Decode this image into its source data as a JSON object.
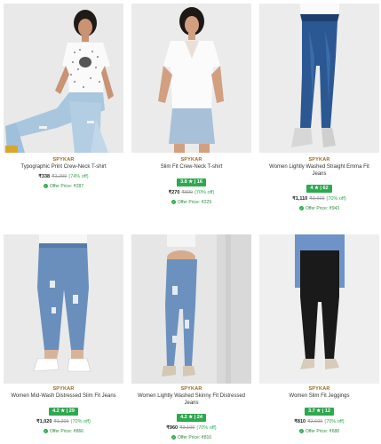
{
  "products": [
    {
      "brand": "SPYKAR",
      "name": "Typographic Print Crew-Neck T-shirt",
      "rating": "",
      "price": "₹338",
      "mrp": "₹1,299",
      "discount": "(74% off)",
      "offer": "Offer Price: ₹287"
    },
    {
      "brand": "SPYKAR",
      "name": "Slim Fit Crew-Neck T-shirt",
      "rating": "3.8 ★ | 16",
      "price": "₹270",
      "mrp": "₹899",
      "discount": "(70% off)",
      "offer": "Offer Price: ₹229"
    },
    {
      "brand": "SPYKAR",
      "name": "Women Lightly Washed Straight Emma Fit Jeans",
      "rating": "4 ★ | 62",
      "price": "₹1,110",
      "mrp": "₹3,699",
      "discount": "(70% off)",
      "offer": "Offer Price: ₹943"
    },
    {
      "brand": "SPYKAR",
      "name": "Women Mid-Wash Distressed Slim Fit Jeans",
      "rating": "4.2 ★ | 29",
      "price": "₹1,020",
      "mrp": "₹3,399",
      "discount": "(70% off)",
      "offer": "Offer Price: ₹866"
    },
    {
      "brand": "SPYKAR",
      "name": "Women Lightly Washed Skinny Fit Distressed Jeans",
      "rating": "4.2 ★ | 24",
      "price": "₹960",
      "mrp": "₹3,199",
      "discount": "(70% off)",
      "offer": "Offer Price: ₹816"
    },
    {
      "brand": "SPYKAR",
      "name": "Women Slim Fit Jeggings",
      "rating": "3.7 ★ | 12",
      "price": "₹810",
      "mrp": "₹2,699",
      "discount": "(70% off)",
      "offer": "Offer Price: ₹688"
    }
  ],
  "colors": {
    "rating_bg": "#2fa84f",
    "brand": "#9a6a1e",
    "offer": "#2e8b3e"
  },
  "icons": {
    "offer": "check-circle-icon"
  }
}
